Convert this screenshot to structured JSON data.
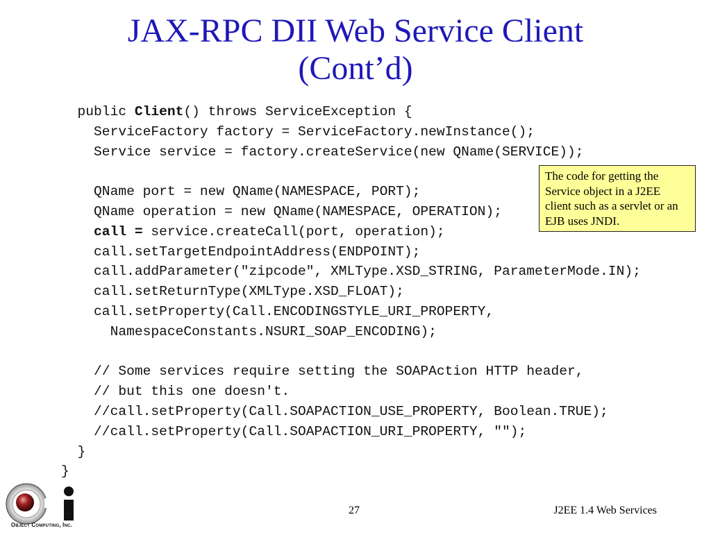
{
  "slide": {
    "title_line1": "JAX-RPC DII Web Service Client",
    "title_line2": "(Cont’d)",
    "page_number": "27",
    "course": "J2EE 1.4 Web Services",
    "logo_text": "Object Computing, Inc.",
    "accent_color": "#1e18b8"
  },
  "code": [
    {
      "indent": "  ",
      "parts": [
        {
          "t": "public "
        },
        {
          "t": "Client",
          "b": true
        },
        {
          "t": "() throws ServiceException {"
        }
      ]
    },
    {
      "indent": "    ",
      "parts": [
        {
          "t": "ServiceFactory factory = ServiceFactory.newInstance();"
        }
      ]
    },
    {
      "indent": "    ",
      "parts": [
        {
          "t": "Service service = factory.createService(new QName(SERVICE));"
        }
      ]
    },
    {
      "indent": "",
      "parts": []
    },
    {
      "indent": "    ",
      "parts": [
        {
          "t": "QName port = new QName(NAMESPACE, PORT);"
        }
      ]
    },
    {
      "indent": "    ",
      "parts": [
        {
          "t": "QName operation = new QName(NAMESPACE, OPERATION);"
        }
      ]
    },
    {
      "indent": "    ",
      "parts": [
        {
          "t": "call =",
          "b": true
        },
        {
          "t": " service.createCall(port, operation);"
        }
      ]
    },
    {
      "indent": "    ",
      "parts": [
        {
          "t": "call.setTargetEndpointAddress(ENDPOINT);"
        }
      ]
    },
    {
      "indent": "    ",
      "parts": [
        {
          "t": "call.addParameter(\"zipcode\", XMLType.XSD_STRING, ParameterMode.IN);"
        }
      ]
    },
    {
      "indent": "    ",
      "parts": [
        {
          "t": "call.setReturnType(XMLType.XSD_FLOAT);"
        }
      ]
    },
    {
      "indent": "    ",
      "parts": [
        {
          "t": "call.setProperty(Call.ENCODINGSTYLE_URI_PROPERTY,"
        }
      ]
    },
    {
      "indent": "      ",
      "parts": [
        {
          "t": "NamespaceConstants.NSURI_SOAP_ENCODING);"
        }
      ]
    },
    {
      "indent": "",
      "parts": []
    },
    {
      "indent": "    ",
      "parts": [
        {
          "t": "// Some services require setting the SOAPAction HTTP header,"
        }
      ]
    },
    {
      "indent": "    ",
      "parts": [
        {
          "t": "// but this one doesn't."
        }
      ]
    },
    {
      "indent": "    ",
      "parts": [
        {
          "t": "//call.setProperty(Call.SOAPACTION_USE_PROPERTY, Boolean.TRUE);"
        }
      ]
    },
    {
      "indent": "    ",
      "parts": [
        {
          "t": "//call.setProperty(Call.SOAPACTION_URI_PROPERTY, \"\");"
        }
      ]
    },
    {
      "indent": "  ",
      "parts": [
        {
          "t": "}"
        }
      ]
    },
    {
      "indent": "",
      "parts": [
        {
          "t": "}"
        }
      ]
    }
  ],
  "note": {
    "text": "The code for getting the Service object in a J2EE client such as a servlet or an EJB uses JNDI."
  }
}
